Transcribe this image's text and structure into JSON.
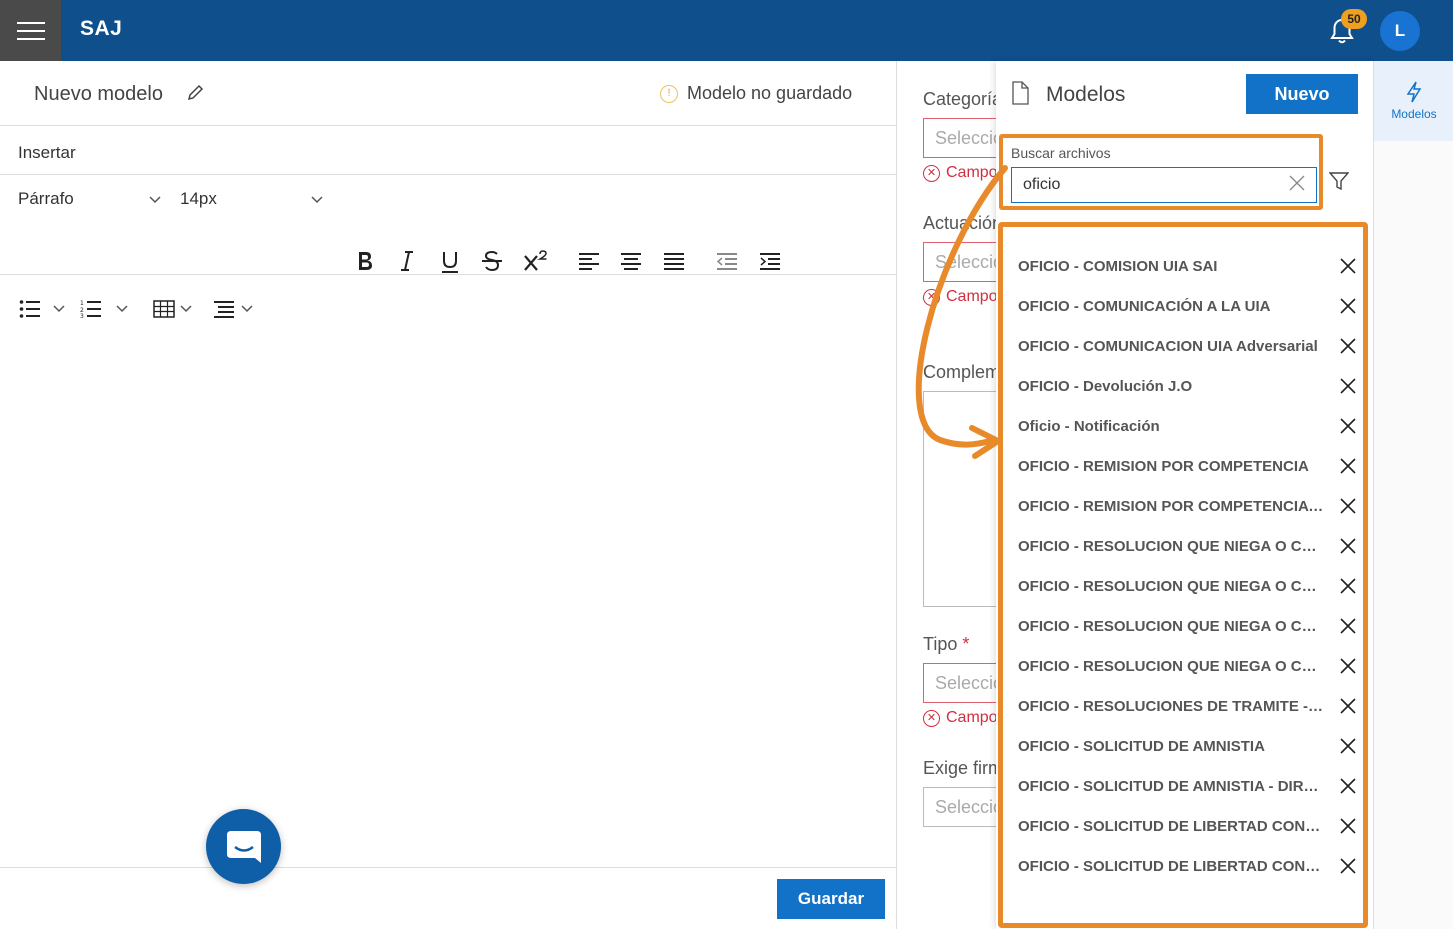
{
  "header": {
    "app_title": "SAJ",
    "notifications_count": "50",
    "user_initial": "L"
  },
  "editor": {
    "title": "Nuevo modelo",
    "status": "Modelo no guardado",
    "insert_menu": "Insertar",
    "paragraph_style": "Párrafo",
    "font_size": "14px",
    "save_label": "Guardar"
  },
  "form": {
    "category_label": "Categoría",
    "actuacion_label": "Actuación",
    "complemento_label": "Complemento",
    "tipo_label": "Tipo",
    "exige_firma_label": "Exige firma",
    "select_placeholder": "Seleccione",
    "required_error": "Campo"
  },
  "models_panel": {
    "title": "Modelos",
    "new_label": "Nuevo",
    "search_label": "Buscar archivos",
    "search_value": "oficio",
    "results": [
      "OFICIO - COMISION UIA SAI",
      "OFICIO - COMUNICACIÓN A LA UIA",
      "OFICIO - COMUNICACION UIA Adversarial",
      "OFICIO - Devolución J.O",
      "Oficio - Notificación",
      "OFICIO - REMISION POR COMPETENCIA",
      "OFICIO - REMISION POR COMPETENCIA - ...",
      "OFICIO - RESOLUCION QUE NIEGA O CON...",
      "OFICIO - RESOLUCION QUE NIEGA O CON...",
      "OFICIO - RESOLUCION QUE NIEGA O CON...",
      "OFICIO - RESOLUCION QUE NIEGA O CON...",
      "OFICIO - RESOLUCIONES DE TRAMITE - DI...",
      "OFICIO - SOLICITUD DE AMNISTIA",
      "OFICIO - SOLICITUD DE AMNISTIA - DIREC...",
      "OFICIO - SOLICITUD DE LIBERTAD CONDIC...",
      "OFICIO - SOLICITUD DE LIBERTAD CONDIC..."
    ]
  },
  "rail": {
    "models_tab_label": "Modelos"
  },
  "colors": {
    "header": "#0f4f8c",
    "primary": "#1272c8",
    "highlight": "#e8892a",
    "error": "#d03040"
  }
}
